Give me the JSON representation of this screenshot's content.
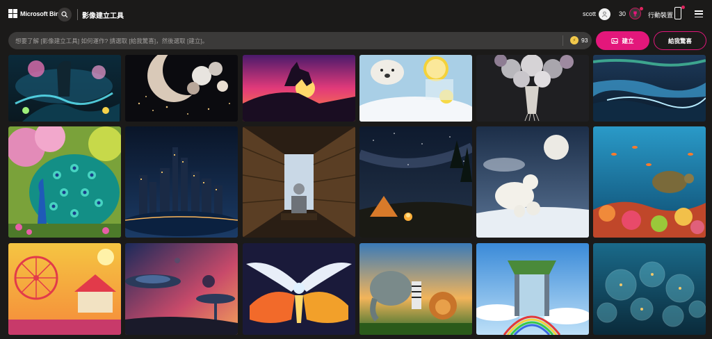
{
  "header": {
    "brand": "Microsoft Bing",
    "app_title": "影像建立工具",
    "user_name": "scott",
    "coins": "30",
    "mobile_label": "行動裝置"
  },
  "prompt": {
    "placeholder": "想要了解 [影像建立工具] 如何運作? 請選取 [給我驚喜]，然後選取 [建立]。",
    "boosts": "93"
  },
  "buttons": {
    "create": "建立",
    "surprise": "給我驚喜"
  },
  "gallery": {
    "images": [
      "fantasy-glowing-forest",
      "crescent-moon-flowers",
      "rider-silhouette-sunset",
      "polar-bear-lemon-drink",
      "flower-bouquet-silver",
      "icy-coast-aurora",
      "peacock-garden",
      "night-city-skyline",
      "robot-library",
      "campfire-tent-milky-way",
      "polar-bears-full-moon",
      "sea-turtle-coral-reef",
      "carnival-ferris-wheel",
      "space-station-nebula",
      "fire-phoenix",
      "safari-animals",
      "rainbow-waterfall-islands",
      "underwater-glass-domes"
    ]
  }
}
